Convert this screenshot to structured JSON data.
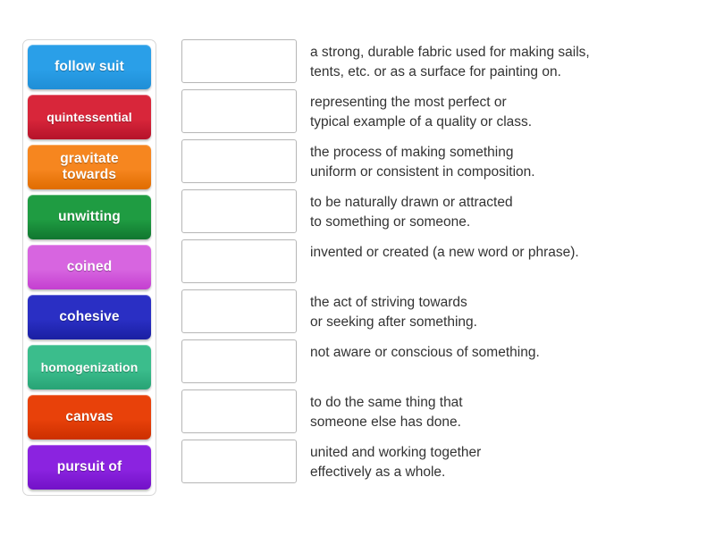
{
  "activity": {
    "type": "match-up",
    "tiles": [
      {
        "label": "follow suit",
        "color": "#2a9fe8",
        "color_dark": "#1f8ed6"
      },
      {
        "label": "quintessential",
        "color": "#d8263a",
        "color_dark": "#b5122a"
      },
      {
        "label": "gravitate\ntowards",
        "color": "#f6861f",
        "color_dark": "#e06c00"
      },
      {
        "label": "unwitting",
        "color": "#1f9c42",
        "color_dark": "#10762f"
      },
      {
        "label": "coined",
        "color": "#d765e0",
        "color_dark": "#c43fd0"
      },
      {
        "label": "cohesive",
        "color": "#2a2fc4",
        "color_dark": "#1a1fa2"
      },
      {
        "label": "homogenization",
        "color": "#3bbd8c",
        "color_dark": "#27a375"
      },
      {
        "label": "canvas",
        "color": "#e8410a",
        "color_dark": "#cc2f00"
      },
      {
        "label": "pursuit of",
        "color": "#8b23e0",
        "color_dark": "#7211c7"
      }
    ],
    "rows": [
      {
        "answer": "",
        "definition": "a strong, durable fabric used for making sails,\ntents, etc. or as a surface for painting on."
      },
      {
        "answer": "",
        "definition": "representing the most perfect or\ntypical example of a quality or class."
      },
      {
        "answer": "",
        "definition": "the process of making something\nuniform or consistent in composition."
      },
      {
        "answer": "",
        "definition": "to be naturally drawn or attracted\nto something or someone."
      },
      {
        "answer": "",
        "definition": "invented or created (a new word or phrase)."
      },
      {
        "answer": "",
        "definition": "the act of striving towards\nor seeking after something."
      },
      {
        "answer": "",
        "definition": "not aware or conscious of something."
      },
      {
        "answer": "",
        "definition": "to do the same thing that\nsomeone else has done."
      },
      {
        "answer": "",
        "definition": "united and working together\neffectively as a whole."
      }
    ]
  }
}
